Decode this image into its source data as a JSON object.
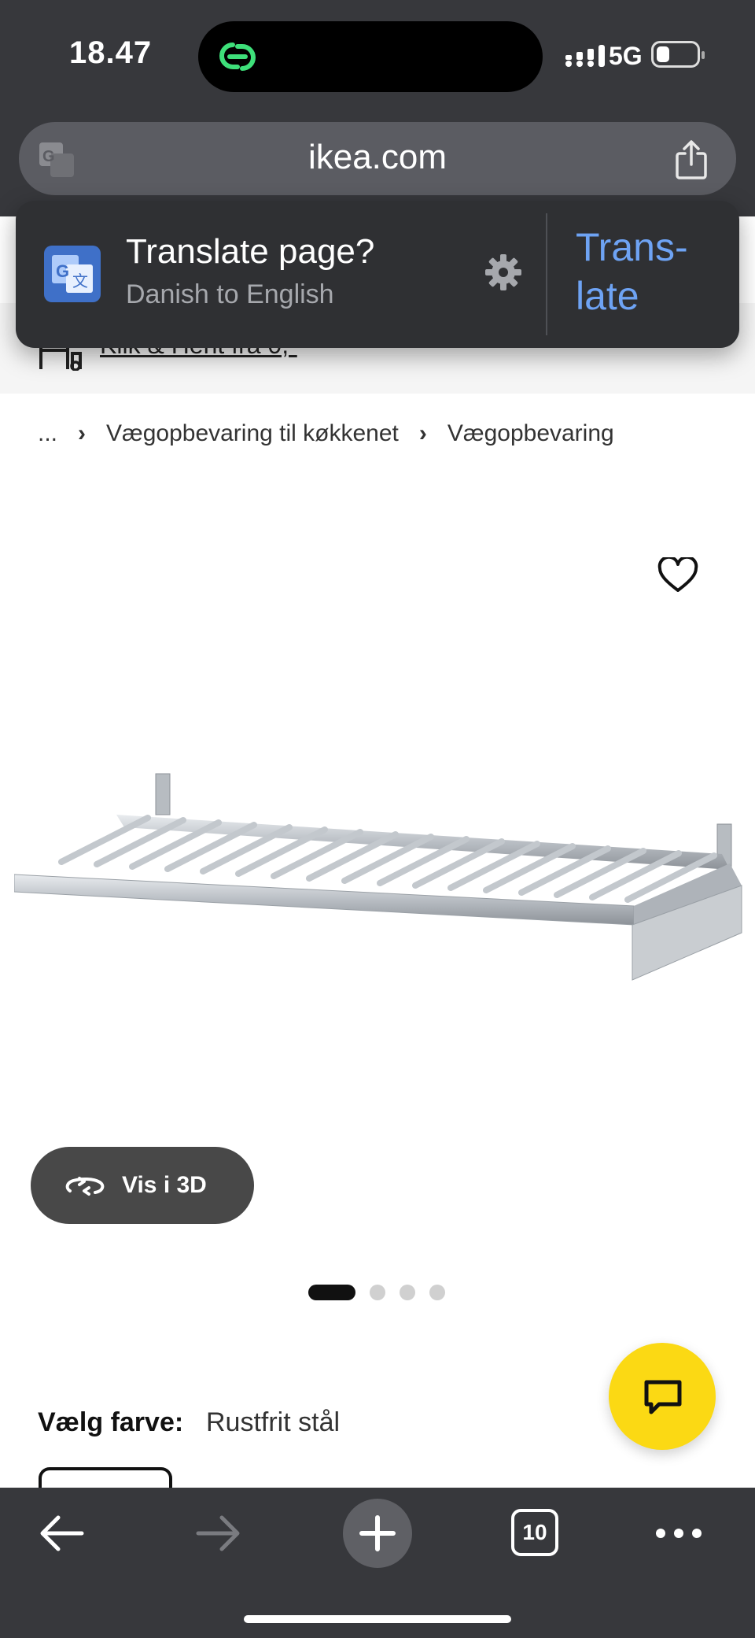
{
  "status_bar": {
    "time": "18.47",
    "network": "5G"
  },
  "browser": {
    "url": "ikea.com",
    "open_tabs": "10"
  },
  "translate_popup": {
    "title": "Translate page?",
    "subtitle": "Danish to English",
    "button": "Trans-\nlate",
    "button_line1": "Trans-",
    "button_line2": "late"
  },
  "store_banner": {
    "link": "Klik & Hent fra 0,-"
  },
  "breadcrumb": {
    "ellipsis": "...",
    "items": [
      "Vægopbevaring til køkkenet",
      "Vægopbevaring"
    ]
  },
  "gallery": {
    "view_3d_label": "Vis i 3D",
    "image_count": 4,
    "active_index": 0
  },
  "product": {
    "color_label": "Vælg farve:",
    "color_value": "Rustfrit stål"
  },
  "colors": {
    "chrome": "#37383c",
    "translate_accent": "#6ea3f4",
    "chat_button": "#fbd914"
  }
}
